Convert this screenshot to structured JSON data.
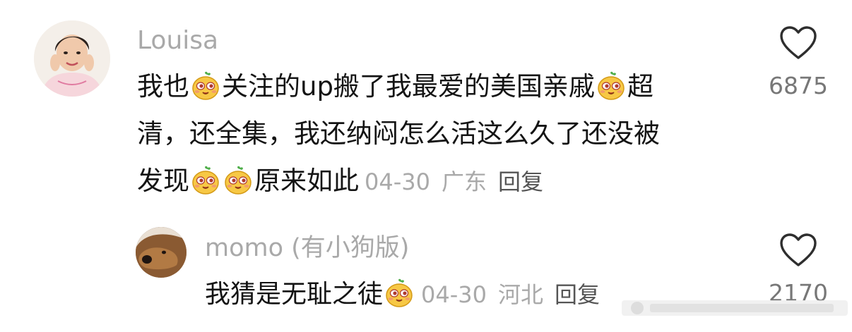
{
  "comments": [
    {
      "username": "Louisa",
      "line1_a": "我也",
      "line1_b": "关注的up搬了我最爱的美国亲戚",
      "line1_c": "超",
      "line2": "清，还全集，我还纳闷怎么活这么久了还没被",
      "line3_a": "发现",
      "line3_b": "原来如此",
      "date": "04-30",
      "location": "广东",
      "reply_label": "回复",
      "likes": "6875",
      "emoji_name": "smug-sprout-emoji"
    },
    {
      "username": "momo (有小狗版)",
      "text": "我猜是无耻之徒",
      "date": "04-30",
      "location": "河北",
      "reply_label": "回复",
      "likes": "2170",
      "emoji_name": "smug-sprout-emoji"
    }
  ],
  "icons": {
    "like": "heart-outline-icon"
  },
  "colors": {
    "text": "#141414",
    "muted": "#a9a9a9",
    "emoji_face": "#f7c845"
  }
}
